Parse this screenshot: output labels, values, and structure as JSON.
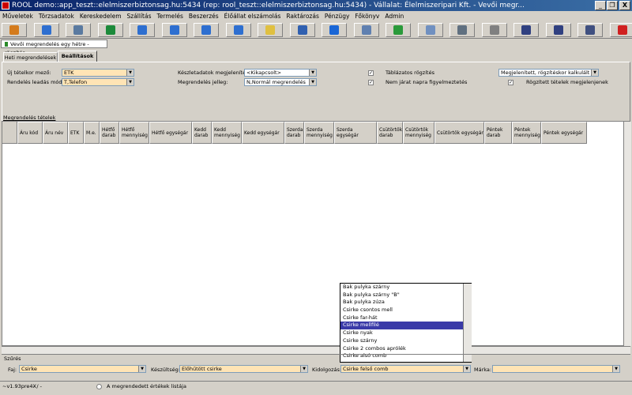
{
  "window": {
    "title": "ROOL demo::app_teszt::elelmiszerbiztonsag.hu:5434 (rep: rool_teszt::elelmiszerbiztonsag.hu:5434) - Vállalat: Élelmiszeripari Kft. - Vevői megr...",
    "minimize": "_",
    "restore": "❐",
    "close": "X"
  },
  "menu": [
    "Műveletek",
    "Törzsadatok",
    "Kereskedelem",
    "Szállítás",
    "Termelés",
    "Beszerzés",
    "Élőállat elszámolás",
    "Raktározás",
    "Pénzügy",
    "Főkönyv",
    "Admin"
  ],
  "toolbar": {
    "icons": [
      "open-icon",
      "export-icon",
      "save-icon",
      "refresh-icon",
      "first-icon",
      "prev-icon",
      "next-icon",
      "last-icon",
      "edit-icon",
      "clipboard-icon",
      "info-icon",
      "form-icon",
      "recycle-icon",
      "find-icon",
      "list-icon",
      "print-icon",
      "grid-icon",
      "columns-icon",
      "window-icon",
      "close-icon"
    ],
    "colors": [
      "#d47b1c",
      "#2e6fd0",
      "#5a7aa0",
      "#1c8a3a",
      "#2e6fd0",
      "#2e6fd0",
      "#2e6fd0",
      "#2e6fd0",
      "#e0c040",
      "#3060b0",
      "#1a66d6",
      "#6080b0",
      "#2a9a3a",
      "#7090c0",
      "#607080",
      "#808080",
      "#304080",
      "#304080",
      "#405080",
      "#d02020"
    ]
  },
  "document_tab": "Vevői megrendelés egy hétre - rögzítés",
  "tabs": {
    "tab1": "Heti megrendelések",
    "tab2": "Beállítások"
  },
  "settings": {
    "new_item_field_label": "Új tételkor mező:",
    "new_item_field_value": "ETK",
    "order_mode_label": "Rendelés leadás mód:",
    "order_mode_value": "T,Telefon",
    "stock_display_label": "Készletadatok megjelenítés:",
    "stock_display_value": "<Kikapcsolt>",
    "order_type_label": "Megrendelés jelleg:",
    "order_type_value": "N,Normál megrendelés",
    "table_entry_label": "Táblázatos rögzítés",
    "table_entry_checked": "✓",
    "no_route_label": "Nem járat napra figyelmeztetés",
    "no_route_checked": "✓",
    "calc_value": "Megjelenített, rögzítéskor kalkulált",
    "show_saved_label": "Rögzített tételek megjelenjenek",
    "show_saved_checked": "✓"
  },
  "items_section_label": "Megrendelés tételek",
  "columns": [
    "Áru kód",
    "Áru név",
    "ETK",
    "M.e.",
    "Hétfő darab",
    "Hétfő mennyiség",
    "Hétfő egységár",
    "Kedd darab",
    "Kedd mennyiség",
    "Kedd egységár",
    "Szerda darab",
    "Szerda mennyiség",
    "Szerda egységár",
    "Csütörtök darab",
    "Csütörtök mennyiség",
    "Csütörtök egységár",
    "Péntek darab",
    "Péntek mennyiség",
    "Péntek egységár"
  ],
  "dropdown_items": [
    "Bak pulyka szárny",
    "Bak pulyka szárny \"B\"",
    "Bak pulyka zúza",
    "Csirke csontos mell",
    "Csirke far-hát",
    "Csirke mellfilé",
    "Csirke nyak",
    "Csirke szárny",
    "Csirke 2 combos aprólék",
    "Csirke alsó comb"
  ],
  "dropdown_selected_index": 5,
  "filter": {
    "section_label": "Szűrés",
    "species_label": "Faj:",
    "species_value": "Csirke",
    "readiness_label": "Készültség:",
    "readiness_value": "Előhűtött csirke",
    "processing_label": "Kidolgozás:",
    "processing_value": "Csirke felső comb",
    "brand_label": "Márka:",
    "brand_value": ""
  },
  "status": {
    "version": "~v1.93pre4X",
    "separator": "- / -",
    "ordered_values_label": "A megrendedett értékek listája"
  }
}
